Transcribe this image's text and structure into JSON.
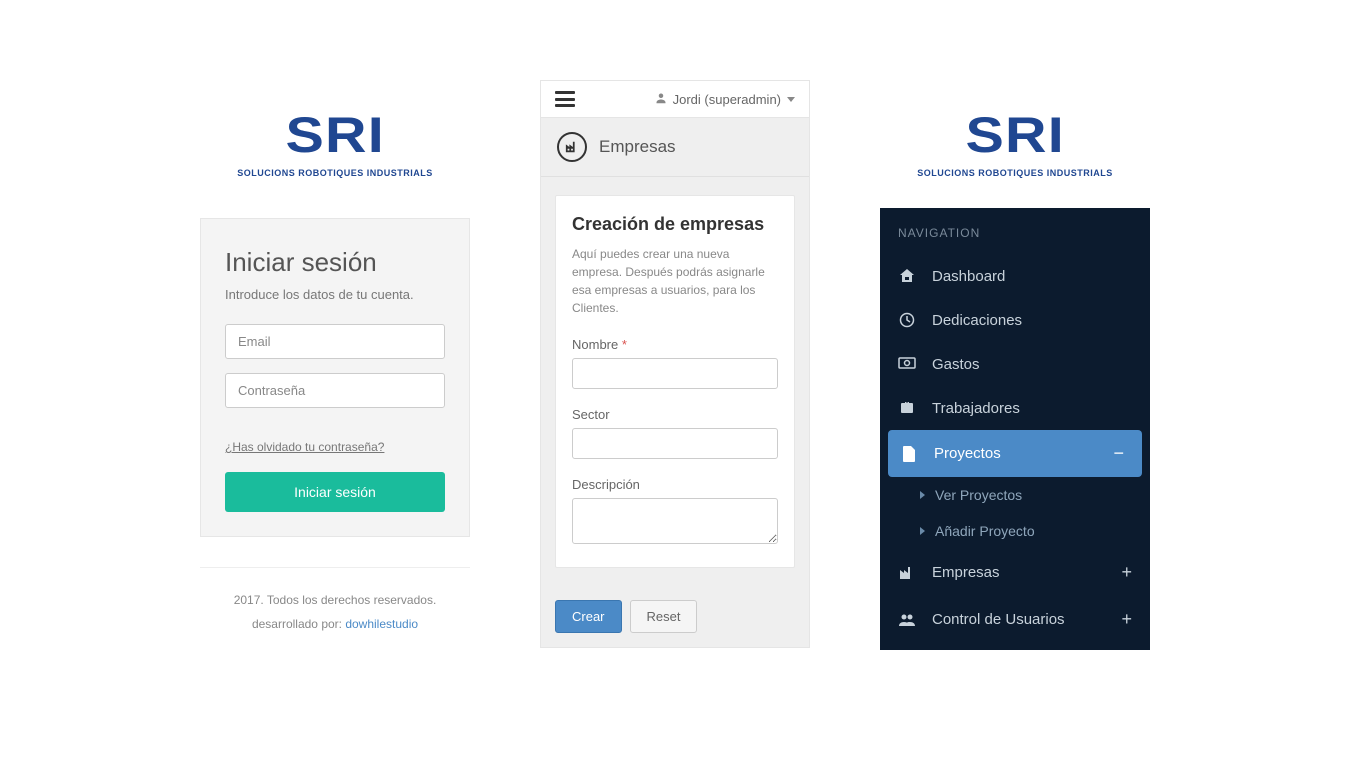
{
  "brand": {
    "logo_text": "SRI",
    "tagline": "SOLUCIONS ROBOTIQUES INDUSTRIALS"
  },
  "login": {
    "title": "Iniciar sesión",
    "subtitle": "Introduce los datos de tu cuenta.",
    "email_placeholder": "Email",
    "password_placeholder": "Contraseña",
    "forgot": "¿Has olvidado tu contraseña?",
    "submit": "Iniciar sesión",
    "footer_copy": "2017. Todos los derechos reservados.",
    "footer_dev_prefix": "desarrollado por: ",
    "footer_dev_link": "dowhilestudio"
  },
  "empresas": {
    "user_label": "Jordi (superadmin)",
    "header_title": "Empresas",
    "card_title": "Creación de empresas",
    "card_desc": "Aquí puedes crear una nueva empresa. Después podrás asignarle esa empresas a usuarios, para los Clientes.",
    "fields": {
      "nombre_label": "Nombre",
      "sector_label": "Sector",
      "descripcion_label": "Descripción"
    },
    "buttons": {
      "crear": "Crear",
      "reset": "Reset"
    }
  },
  "nav": {
    "heading": "NAVIGATION",
    "items": {
      "dashboard": "Dashboard",
      "dedicaciones": "Dedicaciones",
      "gastos": "Gastos",
      "trabajadores": "Trabajadores",
      "proyectos": "Proyectos",
      "ver_proyectos": "Ver Proyectos",
      "anadir_proyecto": "Añadir Proyecto",
      "empresas": "Empresas",
      "control_usuarios": "Control de Usuarios"
    }
  }
}
